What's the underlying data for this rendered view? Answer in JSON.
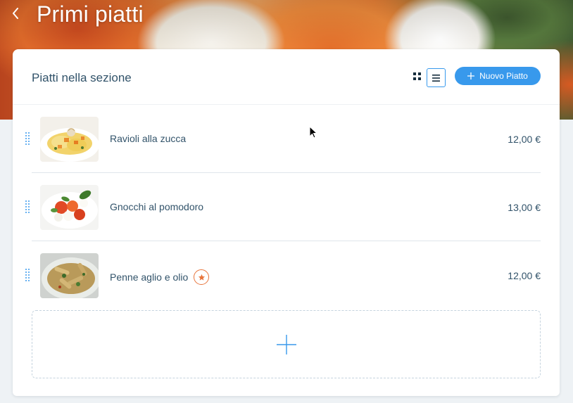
{
  "header": {
    "title": "Primi piatti"
  },
  "section": {
    "title": "Piatti nella sezione",
    "new_button_label": "Nuovo Piatto",
    "view_modes": [
      "grid-view-icon",
      "list-view-icon"
    ],
    "active_view": "list"
  },
  "dishes": [
    {
      "name": "Ravioli alla zucca",
      "price": "12,00 €",
      "featured": false
    },
    {
      "name": "Gnocchi al pomodoro",
      "price": "13,00 €",
      "featured": false
    },
    {
      "name": "Penne aglio e olio",
      "price": "12,00 €",
      "featured": true
    }
  ],
  "colors": {
    "accent": "#3899ec",
    "text": "#32536a",
    "featured": "#e8743b"
  }
}
